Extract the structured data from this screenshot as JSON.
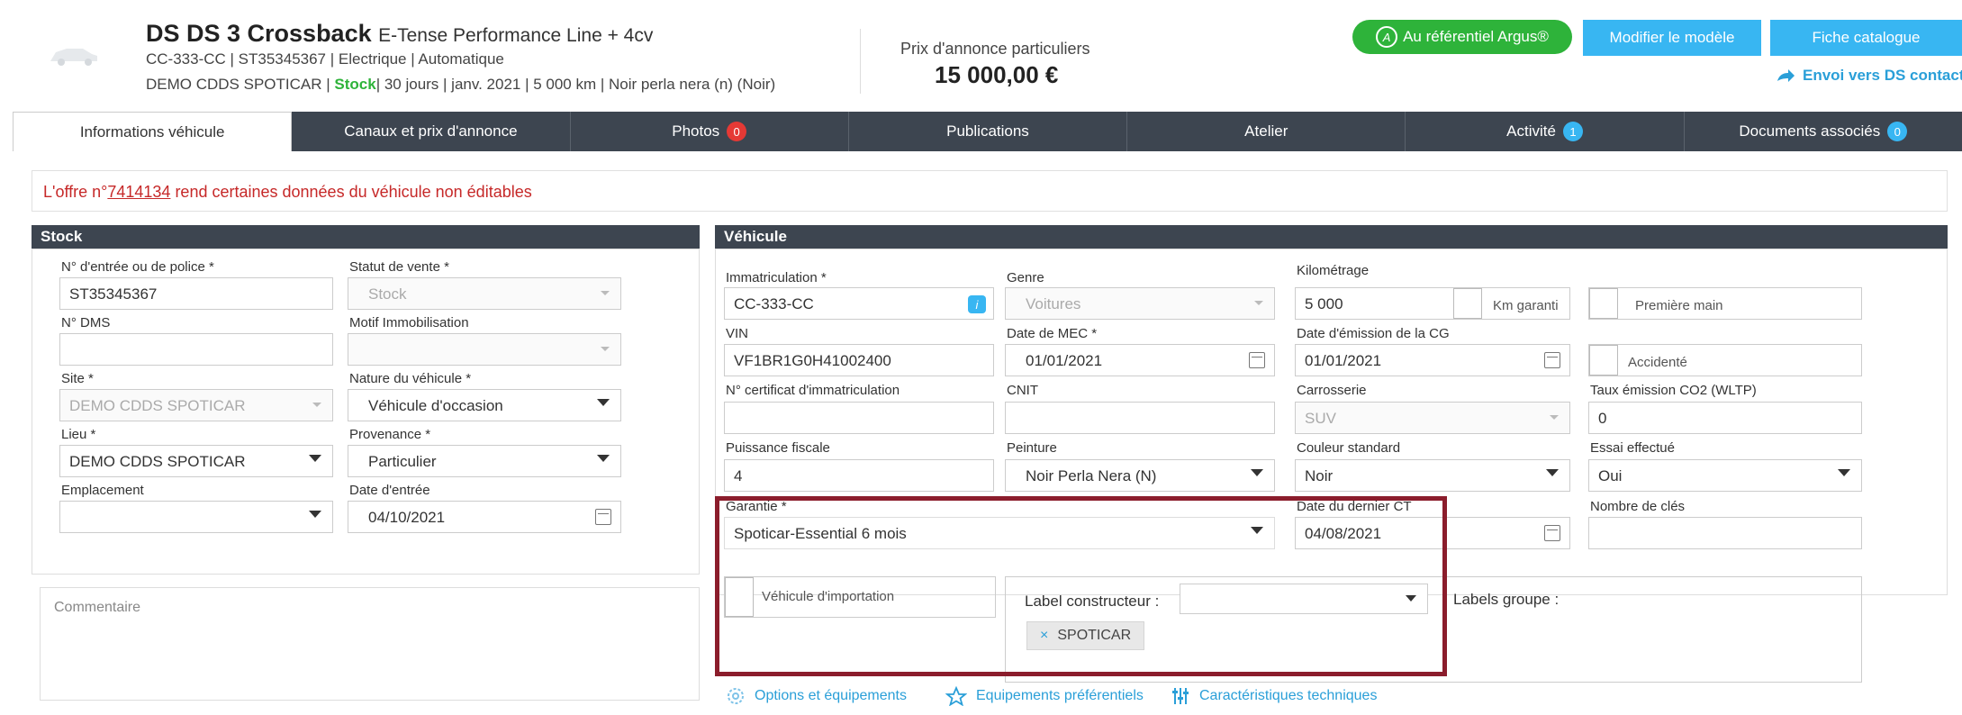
{
  "header": {
    "model": "DS DS 3 Crossback",
    "version": "E-Tense Performance Line + 4cv",
    "line2": "CC-333-CC | ST35345367 | Electrique | Automatique",
    "line3_a": "DEMO CDDS SPOTICAR | ",
    "line3_stock": "Stock",
    "line3_b": "| 30 jours | janv. 2021 | 5 000 km | Noir perla nera (n) (Noir)",
    "price_label": "Prix d'annonce particuliers",
    "price": "15 000,00 €",
    "argus_icon": "A",
    "argus_btn": "Au référentiel Argus®",
    "modify_btn": "Modifier le modèle",
    "catalog_btn": "Fiche catalogue",
    "ds_link": "Envoi vers DS contact"
  },
  "tabs": [
    {
      "label": "Informations véhicule"
    },
    {
      "label": "Canaux et prix d'annonce"
    },
    {
      "label": "Photos",
      "badge": "0",
      "badge_color": "#e53935"
    },
    {
      "label": "Publications"
    },
    {
      "label": "Atelier"
    },
    {
      "label": "Activité",
      "badge": "1",
      "badge_color": "#38b6f2"
    },
    {
      "label": "Documents associés",
      "badge": "0",
      "badge_color": "#38b6f2"
    }
  ],
  "notice": {
    "prefix": "L'offre n°",
    "number": "7414134",
    "suffix": " rend certaines données du véhicule non éditables"
  },
  "stock": {
    "title": "Stock",
    "entry_no_label": "N° d'entrée ou de police *",
    "entry_no": "ST35345367",
    "sale_status_label": "Statut de vente *",
    "sale_status": "Stock",
    "dms_label": "N° DMS",
    "dms": "",
    "immob_label": "Motif Immobilisation",
    "immob": "",
    "site_label": "Site *",
    "site": "DEMO CDDS SPOTICAR",
    "nature_label": "Nature du véhicule *",
    "nature": "Véhicule d'occasion",
    "lieu_label": "Lieu *",
    "lieu": "DEMO CDDS SPOTICAR",
    "provenance_label": "Provenance *",
    "provenance": "Particulier",
    "emplacement_label": "Emplacement",
    "emplacement": "",
    "entry_date_label": "Date d'entrée",
    "entry_date": "04/10/2021",
    "comment_placeholder": "Commentaire"
  },
  "vehicle": {
    "title": "Véhicule",
    "immat_label": "Immatriculation *",
    "immat": "CC-333-CC",
    "immat_info": "i",
    "genre_label": "Genre",
    "genre": "Voitures",
    "km_label": "Kilométrage",
    "km": "5 000",
    "km_garanti": "Km garanti",
    "premiere_main": "Première main",
    "vin_label": "VIN",
    "vin": "VF1BR1G0H41002400",
    "mec_label": "Date de MEC *",
    "mec": "01/01/2021",
    "cg_label": "Date d'émission de la CG",
    "cg": "01/01/2021",
    "accidente": "Accidenté",
    "cert_label": "N° certificat d'immatriculation",
    "cert": "",
    "cnit_label": "CNIT",
    "cnit": "",
    "carrosserie_label": "Carrosserie",
    "carrosserie": "SUV",
    "co2_label": "Taux émission CO2 (WLTP)",
    "co2": "0",
    "puissance_label": "Puissance fiscale",
    "puissance": "4",
    "peinture_label": "Peinture",
    "peinture": "Noir Perla Nera (N)",
    "couleur_label": "Couleur standard",
    "couleur": "Noir",
    "essai_label": "Essai effectué",
    "essai": "Oui",
    "garantie_label": "Garantie *",
    "garantie": "Spoticar-Essential 6 mois",
    "ct_label": "Date du dernier CT",
    "ct": "04/08/2021",
    "cles_label": "Nombre de clés",
    "cles": "",
    "import_label": "Véhicule d'importation",
    "label_constructeur": "Label constructeur :",
    "label_tag": "SPOTICAR",
    "labels_groupe": "Labels groupe :"
  },
  "bottom_links": [
    "Options et équipements",
    "Equipements préférentiels",
    "Caractéristiques techniques"
  ]
}
